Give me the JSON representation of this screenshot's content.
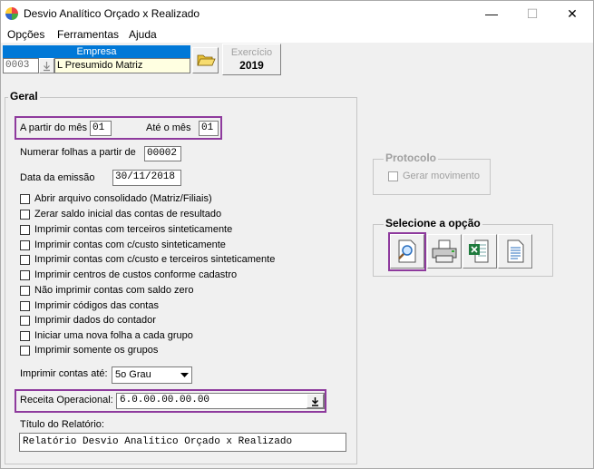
{
  "window": {
    "title": "Desvio Analítico Orçado x Realizado",
    "minimize_glyph": "—",
    "maximize_glyph": "☐",
    "close_glyph": "✕"
  },
  "menu": {
    "items": [
      {
        "label": "Opções"
      },
      {
        "label": "Ferramentas"
      },
      {
        "label": "Ajuda"
      }
    ]
  },
  "empresa": {
    "header": "Empresa",
    "code": "0003",
    "name": "L Presumido Matriz",
    "open_icon": "folder-open-icon"
  },
  "exercicio": {
    "label": "Exercício",
    "value": "2019"
  },
  "geral": {
    "title": "Geral",
    "from_month_label": "A partir do mês",
    "from_month_value": "01",
    "to_month_label": "Até o mês",
    "to_month_value": "01",
    "number_pages_label": "Numerar folhas a partir de",
    "number_pages_value": "00002",
    "emission_label": "Data da emissão",
    "emission_value": "30/11/2018",
    "options": [
      {
        "label": "Abrir arquivo consolidado (Matriz/Filiais)",
        "checked": false
      },
      {
        "label": "Zerar saldo inicial das contas de resultado",
        "checked": false
      },
      {
        "label": "Imprimir contas com terceiros sinteticamente",
        "checked": false
      },
      {
        "label": "Imprimir contas com c/custo sinteticamente",
        "checked": false
      },
      {
        "label": "Imprimir contas com c/custo e terceiros sinteticamente",
        "checked": false
      },
      {
        "label": "Imprimir centros de custos conforme cadastro",
        "checked": false
      },
      {
        "label": "Não imprimir contas com saldo zero",
        "checked": false
      },
      {
        "label": "Imprimir códigos das contas",
        "checked": false
      },
      {
        "label": "Imprimir dados do contador",
        "checked": false
      },
      {
        "label": "Iniciar uma nova folha a cada grupo",
        "checked": false
      },
      {
        "label": "Imprimir somente os grupos",
        "checked": false
      }
    ],
    "print_until_label": "Imprimir contas até:",
    "print_until_value": "5o Grau",
    "receita_label": "Receita Operacional:",
    "receita_value": "6.0.00.00.00.00",
    "report_title_label": "Título do Relatório:",
    "report_title_value": "Relatório Desvio Analítico Orçado x Realizado"
  },
  "protocolo": {
    "title": "Protocolo",
    "checkbox_label": "Gerar movimento"
  },
  "selecione": {
    "title": "Selecione a opção",
    "buttons": [
      {
        "icon": "preview-magnifier-icon"
      },
      {
        "icon": "printer-icon"
      },
      {
        "icon": "excel-export-icon"
      },
      {
        "icon": "text-document-icon"
      }
    ]
  },
  "colors": {
    "highlight": "#8e3a9d",
    "empresa_header": "#0078d7",
    "empresa_name_bg": "#ffffe1"
  }
}
